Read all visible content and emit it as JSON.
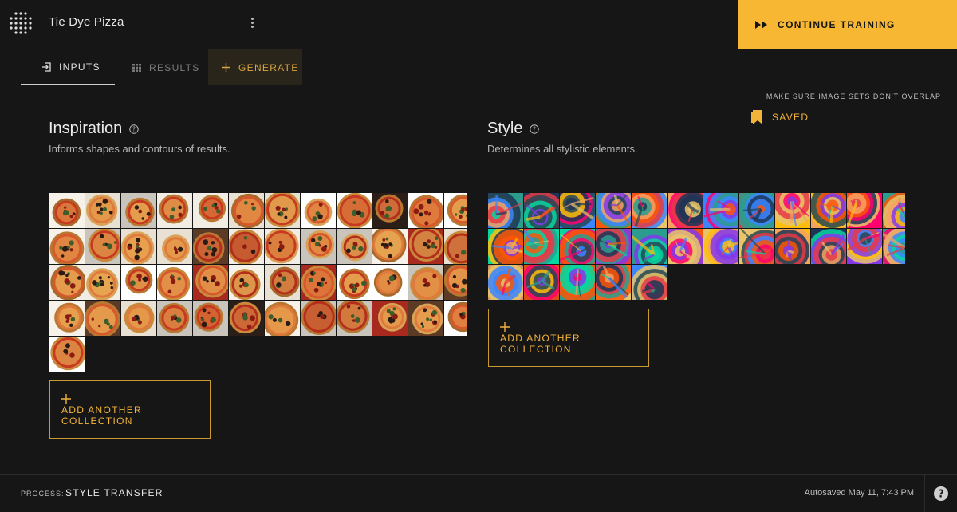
{
  "header": {
    "project_title": "Tie Dye Pizza",
    "continue_label": "CONTINUE TRAINING"
  },
  "tabs": [
    {
      "label": "INPUTS",
      "icon": "input-icon",
      "active": true
    },
    {
      "label": "RESULTS",
      "icon": "grid-icon",
      "active": false
    },
    {
      "label": "GENERATE",
      "icon": "plus-icon",
      "active": false
    }
  ],
  "saved": {
    "label": "SAVED",
    "icon": "bookmark-icon"
  },
  "overlap_note": "MAKE SURE IMAGE SETS DON'T OVERLAP",
  "inspiration": {
    "title": "Inspiration",
    "subtitle": "Informs shapes and contours of results.",
    "add_label": "ADD ANOTHER COLLECTION",
    "image_count": 49
  },
  "style": {
    "title": "Style",
    "subtitle": "Determines all stylistic elements.",
    "add_label": "ADD ANOTHER COLLECTION",
    "image_count": 29
  },
  "footer": {
    "process_label": "PROCESS:",
    "process_value": "STYLE TRANSFER",
    "autosave": "Autosaved May 11, 7:43 PM"
  },
  "colors": {
    "accent": "#f7b733",
    "accent_text": "#f2b33a",
    "background": "#161616"
  }
}
